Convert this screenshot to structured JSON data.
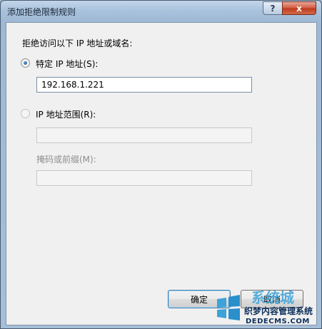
{
  "window": {
    "title": "添加拒绝限制规则",
    "help_label": "?",
    "close_label": "x"
  },
  "form": {
    "prompt": "拒绝访问以下 IP 地址或域名:",
    "specific_ip_label": "特定 IP 地址(S):",
    "specific_ip_value": "192.168.1.221",
    "ip_range_label": "IP 地址范围(R):",
    "ip_range_value": "",
    "mask_label": "掩码或前缀(M):",
    "mask_value": ""
  },
  "buttons": {
    "ok_label": "确定",
    "cancel_label": "取消"
  },
  "watermark": {
    "brand": "系统城",
    "title": "织梦内容管理系统",
    "url": "DEDECMS.COM"
  },
  "colors": {
    "accent": "#3c7fb1",
    "close": "#c03a1d"
  }
}
